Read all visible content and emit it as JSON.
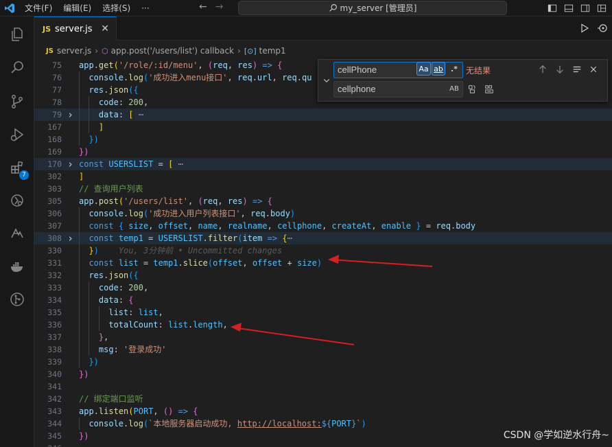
{
  "titlebar": {
    "menu": [
      "文件(F)",
      "编辑(E)",
      "选择(S)"
    ],
    "more": "···",
    "search_text": "my_server [管理员]"
  },
  "activity": {
    "icons": [
      "explorer-icon",
      "search-icon",
      "source-control-icon",
      "run-debug-icon",
      "extensions-icon",
      "remote-explorer-icon",
      "testing-icon",
      "docker-icon",
      "git-graph-icon"
    ],
    "extensions_badge": "7"
  },
  "tab": {
    "badge": "JS",
    "label": "server.js",
    "close": "✕"
  },
  "breadcrumbs": {
    "badge": "JS",
    "file": "server.js",
    "func": "app.post('/users/list') callback",
    "symbol": "temp1"
  },
  "find": {
    "search_value": "cellPhone",
    "replace_value": "cellphone",
    "match_case": "Aa",
    "whole_word": "ab",
    "regex": ".*",
    "preserve_case": "AB",
    "no_results": "无结果"
  },
  "code": {
    "lines": [
      {
        "n": "75",
        "html": "<span class=\"var\">app</span>.<span class=\"fn\">get</span><span class=\"p1\">(</span><span class=\"str\">'/role/:id/menu'</span>, <span class=\"p2\">(</span><span class=\"var\">req</span>, <span class=\"var\">res</span><span class=\"p2\">)</span> <span class=\"kw\">=&gt;</span> <span class=\"p2\">{</span>"
      },
      {
        "n": "76",
        "html": "  <span class=\"var\">console</span>.<span class=\"fn\">log</span><span class=\"p3\">(</span><span class=\"str\">'成功进入menu接口'</span>, <span class=\"var\">req</span>.<span class=\"var\">url</span>, <span class=\"var\">req</span>.<span class=\"var\">qu</span>"
      },
      {
        "n": "77",
        "html": "  <span class=\"var\">res</span>.<span class=\"fn\">json</span><span class=\"p3\">({</span>"
      },
      {
        "n": "78",
        "html": "    <span class=\"var\">code</span>: <span class=\"num\">200</span>,"
      },
      {
        "n": "79",
        "html": "    <span class=\"var\">data</span>: <span class=\"p1\">[</span> <span class=\"dots\">⋯</span>",
        "fold": true,
        "hl": true
      },
      {
        "n": "167",
        "html": "    <span class=\"p1\">]</span>"
      },
      {
        "n": "168",
        "html": "  <span class=\"p3\">})</span>"
      },
      {
        "n": "169",
        "html": "<span class=\"p2\">})</span>"
      },
      {
        "n": "170",
        "html": "<span class=\"kw\">const</span> <span class=\"con\">USERSLIST</span> = <span class=\"p1\">[</span> <span class=\"dots\">⋯</span>",
        "fold": true,
        "hl": true
      },
      {
        "n": "302",
        "html": "<span class=\"p1\">]</span>"
      },
      {
        "n": "303",
        "html": "<span class=\"cm\">// 查询用户列表</span>"
      },
      {
        "n": "305",
        "html": "<span class=\"var\">app</span>.<span class=\"fn\">post</span><span class=\"p1\">(</span><span class=\"str\">'/users/list'</span>, <span class=\"p2\">(</span><span class=\"var\">req</span>, <span class=\"var\">res</span><span class=\"p2\">)</span> <span class=\"kw\">=&gt;</span> <span class=\"p2\">{</span>"
      },
      {
        "n": "306",
        "html": "  <span class=\"var\">console</span>.<span class=\"fn\">log</span><span class=\"p3\">(</span><span class=\"str\">'成功进入用户列表接口'</span>, <span class=\"var\">req</span>.<span class=\"var\">body</span><span class=\"p3\">)</span>"
      },
      {
        "n": "307",
        "html": "  <span class=\"kw\">const</span> <span class=\"p3\">{</span> <span class=\"con\">size</span>, <span class=\"con\">offset</span>, <span class=\"con\">name</span>, <span class=\"con\">realname</span>, <span class=\"con\">cellphone</span>, <span class=\"con\">createAt</span>, <span class=\"con\">enable</span> <span class=\"p3\">}</span> = <span class=\"var\">req</span>.<span class=\"var\">body</span>"
      },
      {
        "n": "308",
        "html": "  <span class=\"kw\">const</span> <span class=\"con\">temp1</span> = <span class=\"con\">USERSLIST</span>.<span class=\"fn\">filter</span><span class=\"p3\">(</span><span class=\"var\">item</span> <span class=\"kw\">=&gt;</span> <span class=\"p1\">{</span><span class=\"dots\">⋯</span>",
        "fold": true,
        "hl": true
      },
      {
        "n": "330",
        "html": "  <span class=\"p1\">}</span><span class=\"p3\">)</span>    <span class=\"ghost\">You, 3分钟前 • Uncommitted changes</span>"
      },
      {
        "n": "331",
        "html": "  <span class=\"kw\">const</span> <span class=\"con\">list</span> = <span class=\"con\">temp1</span>.<span class=\"fn\">slice</span><span class=\"p3\">(</span><span class=\"con\">offset</span>, <span class=\"con\">offset</span> + <span class=\"con\">size</span><span class=\"p3\">)</span>"
      },
      {
        "n": "332",
        "html": "  <span class=\"var\">res</span>.<span class=\"fn\">json</span><span class=\"p3\">({</span>"
      },
      {
        "n": "333",
        "html": "    <span class=\"var\">code</span>: <span class=\"num\">200</span>,"
      },
      {
        "n": "334",
        "html": "    <span class=\"var\">data</span>: <span class=\"p2\">{</span>"
      },
      {
        "n": "335",
        "html": "      <span class=\"var\">list</span>: <span class=\"con\">list</span>,"
      },
      {
        "n": "336",
        "html": "      <span class=\"var\">totalCount</span>: <span class=\"con\">list</span>.<span class=\"con\">length</span>,"
      },
      {
        "n": "337",
        "html": "    <span class=\"p2\">}</span>,"
      },
      {
        "n": "338",
        "html": "    <span class=\"var\">msg</span>: <span class=\"str\">'登录成功'</span>"
      },
      {
        "n": "339",
        "html": "  <span class=\"p3\">})</span>"
      },
      {
        "n": "340",
        "html": "<span class=\"p2\">})</span>"
      },
      {
        "n": "341",
        "html": ""
      },
      {
        "n": "342",
        "html": "<span class=\"cm\">// 绑定端口监听</span>"
      },
      {
        "n": "343",
        "html": "<span class=\"var\">app</span>.<span class=\"fn\">listen</span><span class=\"p1\">(</span><span class=\"con\">PORT</span>, <span class=\"p2\">()</span> <span class=\"kw\">=&gt;</span> <span class=\"p2\">{</span>"
      },
      {
        "n": "344",
        "html": "  <span class=\"var\">console</span>.<span class=\"fn\">log</span><span class=\"p3\">(</span><span class=\"str\">`本地服务器启动成功, </span><span class=\"link\">http://localhost:</span><span class=\"kw\">${</span><span class=\"con\">PORT</span><span class=\"kw\">}</span><span class=\"str\">`</span><span class=\"p3\">)</span>"
      },
      {
        "n": "345",
        "html": "<span class=\"p2\">})</span>"
      },
      {
        "n": "346",
        "html": ""
      }
    ]
  },
  "watermark": "CSDN @学如逆水行舟~"
}
